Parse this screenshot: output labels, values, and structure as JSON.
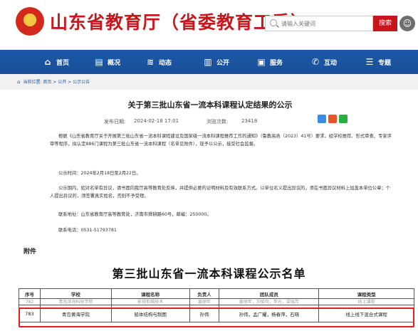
{
  "header": {
    "site_title": "山东省教育厅（省委教育工委）",
    "search_placeholder": "请输入关键词",
    "search_button": "搜索"
  },
  "nav": {
    "items": [
      {
        "label": "首页",
        "icon": "home-icon"
      },
      {
        "label": "概况",
        "icon": "building-icon"
      },
      {
        "label": "动态",
        "icon": "news-icon"
      },
      {
        "label": "公开",
        "icon": "book-icon"
      },
      {
        "label": "服务",
        "icon": "service-icon"
      },
      {
        "label": "互动",
        "icon": "chat-icon"
      },
      {
        "label": "专题",
        "icon": "topic-icon"
      }
    ]
  },
  "breadcrumb": {
    "text": "当前位置: 首页 > 公开 > 公示公告"
  },
  "article": {
    "title": "关于第三批山东省一流本科课程认定结果的公示",
    "publish_label": "发布日期:",
    "publish_date": "2024-02-18 17:01",
    "views_label": "浏览次数:",
    "views": "23418",
    "paragraphs": [
      "根据《山东省教育厅关于开展第三批山东省一流本科课程建设及国家级一流本科课程推荐工作的通知》（鲁教高函（2023）41号）要求，经学校推荐、形式审查、专家评审等程序，拟认定886门课程为第三批山东省一流本科课程（名单见附件），现予以公示，接受社会监督。",
      "公示时间：2024年2月18日至2月22日。",
      "公示期内，如对名单有异议，请书面向我厅高等教育处反映，并提供必要的证明材料及有效联系方式。以单位名义提出异议的，须在书面异议材料上加盖本单位公章；个人提出异议的，须签署真实姓名，否则不予受理。",
      "联系地址：山东省教育厅高等教育处，济南市舜耕路60号，邮编：250000。",
      "联系电话：0531-51793781"
    ]
  },
  "attachment_label": "附件",
  "list": {
    "title": "第三批山东省一流本科课程公示名单",
    "headers": [
      "序号",
      "学校",
      "课程名称",
      "负责人",
      "团队成员",
      "课程类型"
    ],
    "rows": [
      [
        "782",
        "青岛滨海科技学院",
        "影视剪辑技术",
        "姜丽年",
        "姜丽年，刘俊岗，李光，梁瑞芳",
        "线上课程"
      ],
      [
        "783",
        "青岛黄海学院",
        "船体结构与制图",
        "孙伟",
        "孙伟，孟广耀，杨春萍，石晓",
        "线上线下混合式课程"
      ]
    ]
  },
  "colors": {
    "brand_red": "#c8161d",
    "nav_blue": "#1b56a5",
    "highlight_red": "#e02020"
  }
}
